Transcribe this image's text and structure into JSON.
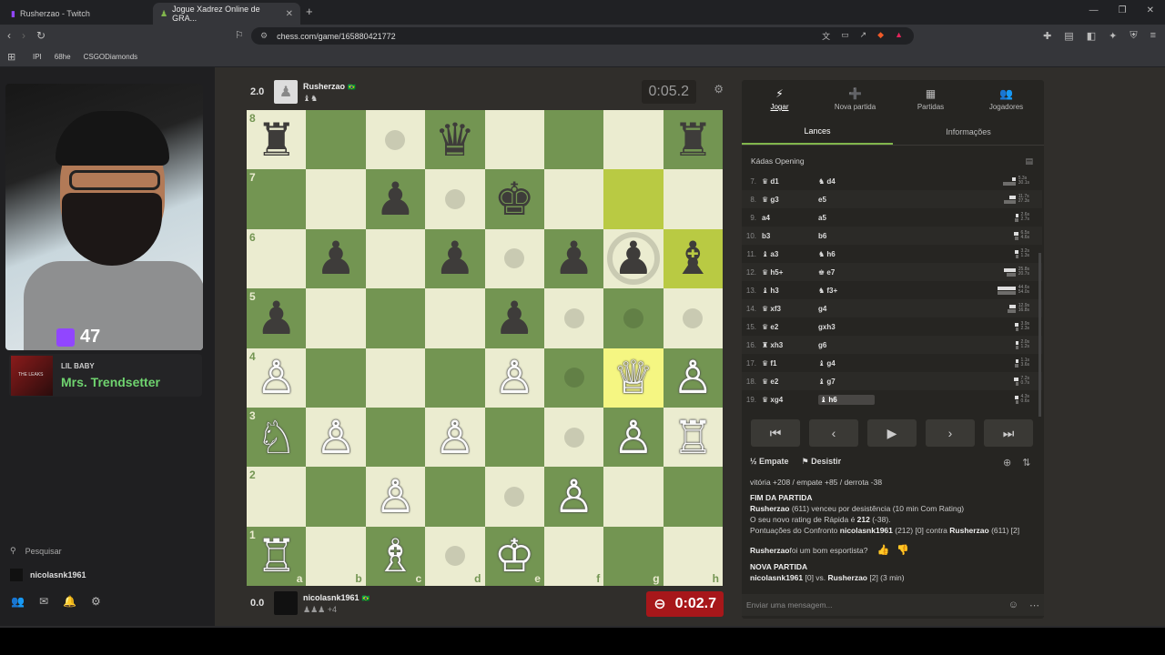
{
  "browser": {
    "tabs": [
      {
        "label": "Rusherzao - Twitch",
        "active": false
      },
      {
        "label": "Jogue Xadrez Online de GRA...",
        "active": true
      }
    ],
    "new_tab": "+",
    "url": "chess.com/game/165880421772",
    "bookmarks": [
      "IPI",
      "68he",
      "CSGODiamonds"
    ]
  },
  "stream": {
    "sub_count": "47",
    "music_artist": "LIL BABY",
    "music_title": "Mrs. Trendsetter",
    "album_text": "THE LEAKS",
    "search_label": "Pesquisar",
    "user": "nicolasnk1961"
  },
  "top_player": {
    "score": "2.0",
    "name": "Rusherzao",
    "flag": "🇧🇷",
    "clock": "0:05.2"
  },
  "bottom_player": {
    "score": "0.0",
    "name": "nicolasnk1961",
    "flag": "🇧🇷",
    "clock": "0:02.7",
    "material": "+4"
  },
  "board": {
    "ranks": [
      "8",
      "7",
      "6",
      "5",
      "4",
      "3",
      "2",
      "1"
    ],
    "files": [
      "a",
      "b",
      "c",
      "d",
      "e",
      "f",
      "g",
      "h"
    ],
    "pieces": [
      [
        "♜",
        "",
        "",
        "♛",
        "",
        "",
        "",
        "♜"
      ],
      [
        "",
        "",
        "♟",
        "",
        "♚",
        "",
        "",
        ""
      ],
      [
        "",
        "♟",
        "",
        "♟",
        "",
        "♟",
        "♟",
        "♝"
      ],
      [
        "♟",
        "",
        "",
        "",
        "♟",
        "",
        "",
        ""
      ],
      [
        "♙",
        "",
        "",
        "",
        "♙",
        "",
        "♕",
        "♙"
      ],
      [
        "♘",
        "♙",
        "",
        "♙",
        "",
        "",
        "♙",
        "♖"
      ],
      [
        "",
        "",
        "♙",
        "",
        "",
        "♙",
        "",
        ""
      ],
      [
        "♖",
        "",
        "♗",
        "",
        "♔",
        "",
        "",
        ""
      ]
    ],
    "highlights": [
      [
        1,
        6
      ],
      [
        2,
        7
      ],
      [
        4,
        6
      ]
    ],
    "dots": [
      [
        0,
        2
      ],
      [
        1,
        3
      ],
      [
        2,
        4
      ],
      [
        3,
        5
      ],
      [
        3,
        6
      ],
      [
        3,
        7
      ],
      [
        4,
        5
      ],
      [
        5,
        5
      ],
      [
        6,
        4
      ],
      [
        7,
        3
      ]
    ],
    "ring": [
      2,
      6
    ]
  },
  "panel": {
    "nav": [
      {
        "label": "Jogar",
        "icon": "⚡"
      },
      {
        "label": "Nova partida",
        "icon": "➕"
      },
      {
        "label": "Partidas",
        "icon": "▦"
      },
      {
        "label": "Jogadores",
        "icon": "👥"
      }
    ],
    "tabs": [
      "Lances",
      "Informações"
    ],
    "opening": "Kádas Opening",
    "moves": [
      {
        "n": "7.",
        "w": "♛ d1",
        "b": "♞ d4",
        "t1": "5.3s",
        "t2": "30.1s"
      },
      {
        "n": "8.",
        "w": "♛ g3",
        "b": "e5",
        "t1": "11.7s",
        "t2": "27.3s"
      },
      {
        "n": "9.",
        "w": "a4",
        "b": "a5",
        "t1": "2.6s",
        "t2": "2.7s"
      },
      {
        "n": "10.",
        "w": "b3",
        "b": "b6",
        "t1": "6.5s",
        "t2": "4.6s"
      },
      {
        "n": "11.",
        "w": "♝ a3",
        "b": "♞ h6",
        "t1": "3.2s",
        "t2": "1.3s"
      },
      {
        "n": "12.",
        "w": "♛ h5+",
        "b": "♚ e7",
        "t1": "25.8s",
        "t2": "20.7s"
      },
      {
        "n": "13.",
        "w": "♝ h3",
        "b": "♞ f3+",
        "t1": "44.6s",
        "t2": "54.0s"
      },
      {
        "n": "14.",
        "w": "♛ xf3",
        "b": "g4",
        "t1": "12.9s",
        "t2": "16.8s"
      },
      {
        "n": "15.",
        "w": "♛ e2",
        "b": "gxh3",
        "t1": "3.9s",
        "t2": "2.3s"
      },
      {
        "n": "16.",
        "w": "♜ xh3",
        "b": "g6",
        "t1": "2.0s",
        "t2": "1.2s"
      },
      {
        "n": "17.",
        "w": "♛ f1",
        "b": "♝ g4",
        "t1": "1.1s",
        "t2": "3.6s"
      },
      {
        "n": "18.",
        "w": "♛ e2",
        "b": "♝ g7",
        "t1": "7.2s",
        "t2": "0.7s"
      },
      {
        "n": "19.",
        "w": "♛ xg4",
        "b": "♝ h6",
        "t1": "4.3s",
        "t2": "0.6s"
      }
    ],
    "draw_label": "Empate",
    "resign_label": "Desistir",
    "record": "vitória +208 / empate +85 / derrota -38",
    "game_over_title": "FIM DA PARTIDA",
    "result_winner": "Rusherzao",
    "result_text": " (611) venceu por desistência (10 min Com Rating)",
    "new_rating_text": "O seu novo rating de Rápida é ",
    "new_rating": "212",
    "rating_delta": " (-38).",
    "score_prefix": "Pontuações do Confronto ",
    "score_p1": "nicolasnk1961",
    "score_mid": " (212) [0] contra ",
    "score_p2": "Rusherzao",
    "score_end": " (611) [2]",
    "sport_name": "Rusherzao",
    "sport_text": " foi um bom esportista?",
    "new_game_title": "NOVA PARTIDA",
    "new_game_p1": "nicolasnk1961",
    "new_game_mid": " [0] vs. ",
    "new_game_p2": "Rusherzao",
    "new_game_end": " [2] (3 min)",
    "chat_placeholder": "Enviar uma mensagem..."
  },
  "colors": {
    "board_light": "#ebecd0",
    "board_dark": "#739552",
    "accent": "#81b64c",
    "clock_low": "#a7171a"
  }
}
